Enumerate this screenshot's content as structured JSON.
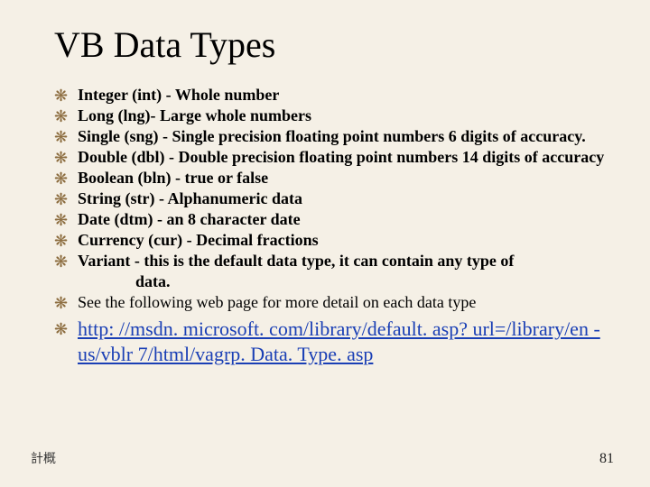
{
  "title": "VB Data Types",
  "bullet_glyph": "❋",
  "items": [
    {
      "bold": "Integer  (int)",
      "rest": " - Whole number"
    },
    {
      "bold": "Long  (lng)",
      "rest": "-  Large whole numbers"
    },
    {
      "bold": "Single  (sng)",
      "rest": "  - Single precision floating point numbers 6 digits of accuracy."
    },
    {
      "bold": "Double  (dbl)",
      "rest": "  - Double precision floating point numbers 14 digits of accuracy"
    },
    {
      "bold": "Boolean  (bln)",
      "rest": "  - true or false"
    },
    {
      "bold": "String (str)",
      "rest": " - Alphanumeric data"
    },
    {
      "bold": "Date (dtm)",
      "rest": "  -  an 8 character date"
    },
    {
      "bold": "Currency (cur)",
      "rest": " - Decimal fractions"
    },
    {
      "bold": "Variant",
      "rest": " -   this is the default data type, it can contain any type of",
      "cont": "data."
    },
    {
      "bold": "",
      "rest": "See the following web page for more detail on each data type"
    }
  ],
  "link_text": "http: //msdn. microsoft. com/library/default. asp? url=/library/en -us/vblr 7/html/vagrp. Data. Type. asp",
  "footer_left": "計概",
  "footer_right": "81"
}
